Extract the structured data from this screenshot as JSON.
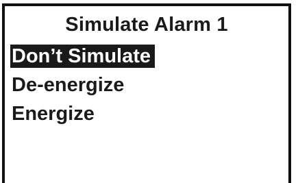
{
  "screen": {
    "title": "Simulate Alarm 1",
    "menu": {
      "items": [
        {
          "label": "Don’t Simulate",
          "selected": true
        },
        {
          "label": "De-energize",
          "selected": false
        },
        {
          "label": "Energize",
          "selected": false
        }
      ]
    }
  },
  "colors": {
    "foreground": "#1a1a1a",
    "background": "#ffffff",
    "highlight_bg": "#1a1a1a",
    "highlight_fg": "#ffffff"
  }
}
